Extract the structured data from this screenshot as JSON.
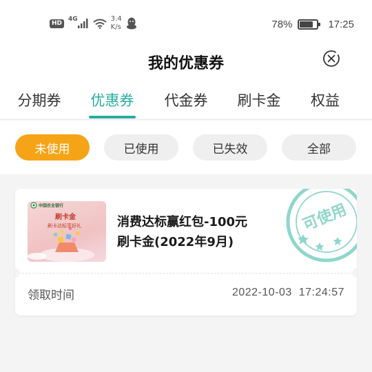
{
  "status_bar": {
    "hd": "HD",
    "network": "4G",
    "speed_value": "3.4",
    "speed_unit": "K/s",
    "battery_percent": "78%",
    "battery_level": 0.78,
    "time": "17:25"
  },
  "header": {
    "title": "我的优惠券",
    "close_icon": "close-circle-icon"
  },
  "tabs": [
    {
      "label": "分期券",
      "active": false
    },
    {
      "label": "优惠券",
      "active": true
    },
    {
      "label": "代金券",
      "active": false
    },
    {
      "label": "刷卡金",
      "active": false
    },
    {
      "label": "权益",
      "active": false
    }
  ],
  "filters": [
    {
      "label": "未使用",
      "active": true
    },
    {
      "label": "已使用",
      "active": false
    },
    {
      "label": "已失效",
      "active": false
    },
    {
      "label": "全部",
      "active": false
    }
  ],
  "coupon": {
    "name_line1": "消费达标赢红包-100元",
    "name_line2": "刷卡金(2022年9月)",
    "stamp_text": "可使用",
    "image_bank": "中国农业银行",
    "image_title": "刷卡金",
    "image_subtitle": "刷卡达标享好礼",
    "footer_label": "领取时间",
    "footer_time": "2022-10-03  17:24:57"
  },
  "colors": {
    "accent": "#27ada0",
    "chip_active": "#f6a417",
    "background": "#f4f4f4"
  }
}
